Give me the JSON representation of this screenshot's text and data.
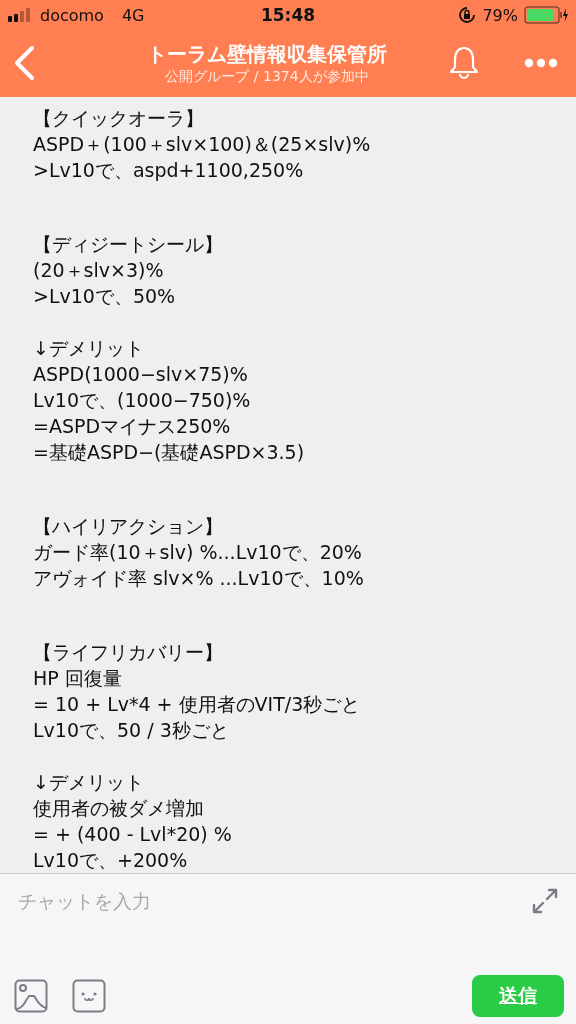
{
  "status_bar": {
    "carrier": "docomo",
    "network": "4G",
    "time": "15:48",
    "battery_percent": "79%"
  },
  "header": {
    "title": "トーラム壁情報収集保管所",
    "subtitle": "公開グループ / 1374人が参加中"
  },
  "note": {
    "sections": [
      {
        "heading": "【クイックオーラ】",
        "paragraphs": [
          [
            "ASPD＋(100＋slv×100)＆(25×slv)%",
            ">Lv10で、aspd+1100,250%"
          ]
        ]
      },
      {
        "heading": "【ディジートシール】",
        "paragraphs": [
          [
            "(20＋slv×3)%",
            ">Lv10で、50%"
          ],
          [
            "↓デメリット",
            "ASPD(1000−slv×75)%",
            "Lv10で、(1000−750)%",
            "=ASPDマイナス250%",
            "=基礎ASPD−(基礎ASPD×3.5)"
          ]
        ]
      },
      {
        "heading": "【ハイリアクション】",
        "paragraphs": [
          [
            "ガード率(10＋slv) %...Lv10で、20%",
            "アヴォイド率 slv×% ...Lv10で、10%"
          ]
        ]
      },
      {
        "heading": "【ライフリカバリー】",
        "paragraphs": [
          [
            "HP 回復量",
            "= 10 + Lv*4 + 使用者のVIT/3秒ごと",
            "Lv10で、50 / 3秒ごと"
          ],
          [
            "↓デメリット",
            "使用者の被ダメ増加",
            "= + (400 - Lvl*20) %",
            "Lv10で、+200%"
          ]
        ]
      }
    ]
  },
  "composer": {
    "placeholder": "チャットを入力",
    "send_label": "送信"
  }
}
